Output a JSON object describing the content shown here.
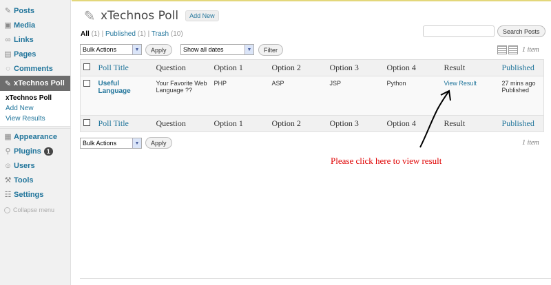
{
  "sidebar": {
    "items": [
      {
        "label": "Posts",
        "icon": "pin-icon"
      },
      {
        "label": "Media",
        "icon": "media-icon"
      },
      {
        "label": "Links",
        "icon": "links-icon"
      },
      {
        "label": "Pages",
        "icon": "pages-icon"
      },
      {
        "label": "Comments",
        "icon": "comments-icon"
      },
      {
        "label": "xTechnos Poll",
        "icon": "pin-icon"
      },
      {
        "label": "Appearance",
        "icon": "appearance-icon"
      },
      {
        "label": "Plugins",
        "icon": "plugins-icon",
        "badge": "1"
      },
      {
        "label": "Users",
        "icon": "users-icon"
      },
      {
        "label": "Tools",
        "icon": "tools-icon"
      },
      {
        "label": "Settings",
        "icon": "settings-icon"
      }
    ],
    "submenu": [
      "xTechnos Poll",
      "Add New",
      "View Results"
    ],
    "collapse": "Collapse menu"
  },
  "header": {
    "title": "xTechnos Poll",
    "add_new": "Add New"
  },
  "filters": {
    "all": "All",
    "all_count": "(1)",
    "published": "Published",
    "published_count": "(1)",
    "trash": "Trash",
    "trash_count": "(10)"
  },
  "search": {
    "button": "Search Posts",
    "value": ""
  },
  "bulk": {
    "label": "Bulk Actions",
    "apply": "Apply"
  },
  "dates": {
    "label": "Show all dates",
    "filter": "Filter"
  },
  "count": "1 item",
  "table": {
    "columns": [
      "Poll Title",
      "Question",
      "Option 1",
      "Option 2",
      "Option 3",
      "Option 4",
      "Result",
      "Published"
    ],
    "rows": [
      {
        "title": "Useful Language",
        "question": "Your Favorite Web Language ??",
        "opt1": "PHP",
        "opt2": "ASP",
        "opt3": "JSP",
        "opt4": "Python",
        "result": "View Result",
        "published_time": "27 mins ago",
        "published_status": "Published"
      }
    ]
  },
  "annotation": "Please click here to view result",
  "colors": {
    "accent": "#21759b",
    "current_menu": "#6d6d6d",
    "annotation": "#e00000"
  }
}
